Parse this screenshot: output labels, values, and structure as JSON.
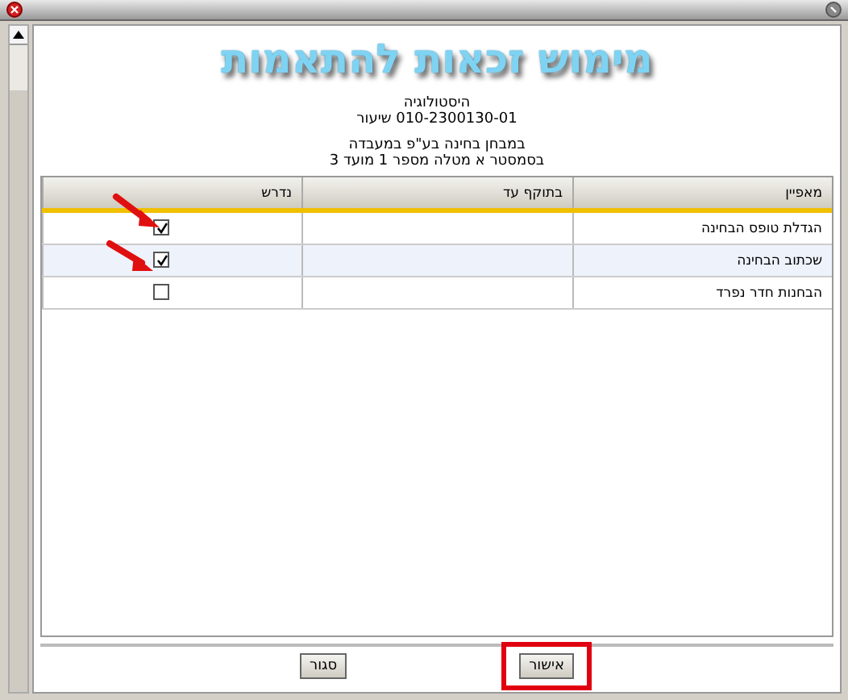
{
  "title": "מימוש זכאות להתאמות",
  "info": [
    "היסטולוגיה",
    "010-2300130-01 שיעור",
    "במבחן בחינה בע\"פ במעבדה",
    "בסמסטר א מטלה מספר 1 מועד 3"
  ],
  "table": {
    "columns": [
      "מאפיין",
      "בתוקף עד",
      "נדרש"
    ],
    "rows": [
      {
        "feature": "הגדלת טופס הבחינה",
        "required": true,
        "marked": true
      },
      {
        "feature": "שכתוב הבחינה",
        "required": true,
        "marked": true
      },
      {
        "feature": "הבחנות חדר נפרד",
        "required": false,
        "marked": false
      }
    ]
  },
  "buttons": [
    {
      "label": "אישור",
      "highlighted": true
    },
    {
      "label": "סגור",
      "highlighted": false
    }
  ]
}
